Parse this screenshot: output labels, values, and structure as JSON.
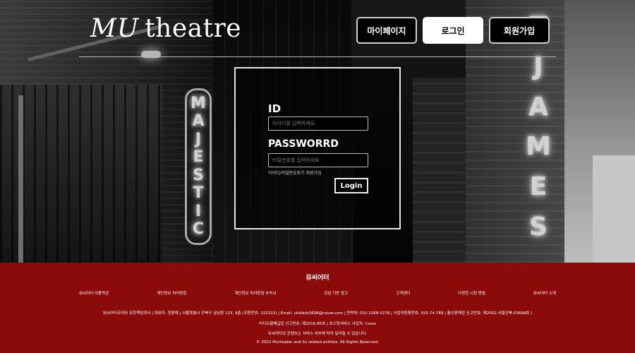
{
  "header": {
    "logo_prefix": "MU",
    "logo_suffix": "theatre",
    "nav": {
      "mypage": "마이페이지",
      "login": "로그인",
      "signup": "회원가입"
    }
  },
  "background_signs": {
    "left": [
      "M",
      "A",
      "J",
      "E",
      "S",
      "T",
      "I",
      "C"
    ],
    "right": [
      "T",
      "J",
      "A",
      "M",
      "E",
      "S"
    ]
  },
  "login": {
    "id_label": "ID",
    "id_placeholder": "아이디를 입력하세요",
    "pw_label": "PASSWORRD",
    "pw_placeholder": "비밀번호를 입력하세요",
    "links_text": "아이디/비밀번호찾기 회원가입",
    "submit": "Login"
  },
  "footer": {
    "title": "뮤씨어터",
    "links": [
      "뮤씨어터 이용약관",
      "개인정보 처리방침",
      "개인정보 처리방침 부속서",
      "관심 기반 광고",
      "고객센터",
      "다양한 시청 방법",
      "뮤씨어터 소개"
    ],
    "info_line1": "뮤씨어터코리아 유한책임회사 | 대표자: 정용재 | 서울특별시 강북구 삼남동 123, 9층 (우편번호: 222222) | Email: ckddnjs3698@naver.com | 연락처: 010 2268 0278 | 사업자등록번호: 555-74-789 | 통신판매업 신고번호: 제2002-서울강북-03698호 |",
    "info_line2": "비디오물배급업 신고번호: 제2016-85호 | 호스팅서비스 사업자: Cssss",
    "info_line3": "뮤씨어터의 콘텐츠는 서비스 여부에 따라 달라질 수 있습니다.",
    "copyright": "© 2022 Mutheater and its related entities. All Rights Reserved."
  },
  "colors": {
    "footer_bg": "#8b0b0b",
    "accent_white": "#ffffff",
    "box_border": "#e6e6e6"
  }
}
